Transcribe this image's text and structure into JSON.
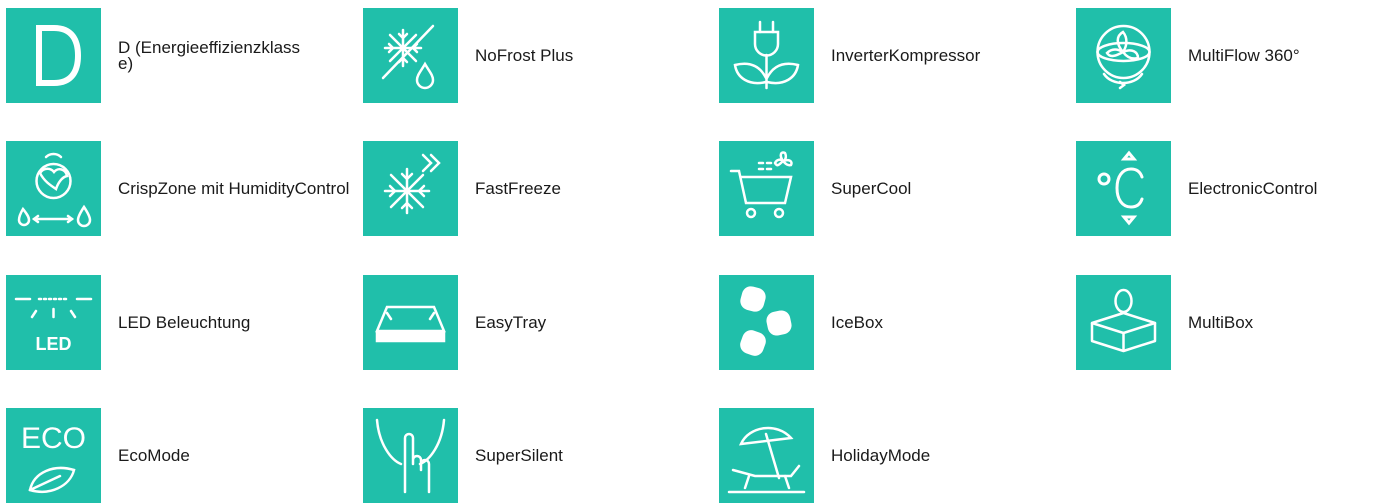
{
  "theme": {
    "tile_color": "#20bfaa",
    "icon_color": "#ffffff",
    "text_color": "#1a1a1a"
  },
  "features": [
    {
      "label": "D (Energieeffizienzklasse)",
      "icon": "energy-class-d-icon"
    },
    {
      "label": "NoFrost Plus",
      "icon": "nofrost-icon"
    },
    {
      "label": "InverterKompressor",
      "icon": "inverter-compressor-icon"
    },
    {
      "label": "MultiFlow 360°",
      "icon": "multiflow-fan-icon"
    },
    {
      "label": "CrispZone mit HumidityControl",
      "icon": "crispzone-humidity-icon"
    },
    {
      "label": "FastFreeze",
      "icon": "fastfreeze-snowflake-icon"
    },
    {
      "label": "SuperCool",
      "icon": "supercool-cart-icon"
    },
    {
      "label": "ElectronicControl",
      "icon": "electronic-control-celsius-icon"
    },
    {
      "label": "LED Beleuchtung",
      "icon": "led-light-icon",
      "icon_text": "LED"
    },
    {
      "label": "EasyTray",
      "icon": "easytray-icon"
    },
    {
      "label": "IceBox",
      "icon": "icebox-icon"
    },
    {
      "label": "MultiBox",
      "icon": "multibox-egg-icon"
    },
    {
      "label": "EcoMode",
      "icon": "ecomode-leaf-icon",
      "icon_text": "ECO"
    },
    {
      "label": "SuperSilent",
      "icon": "supersilent-finger-icon"
    },
    {
      "label": "HolidayMode",
      "icon": "holidaymode-umbrella-icon"
    }
  ]
}
